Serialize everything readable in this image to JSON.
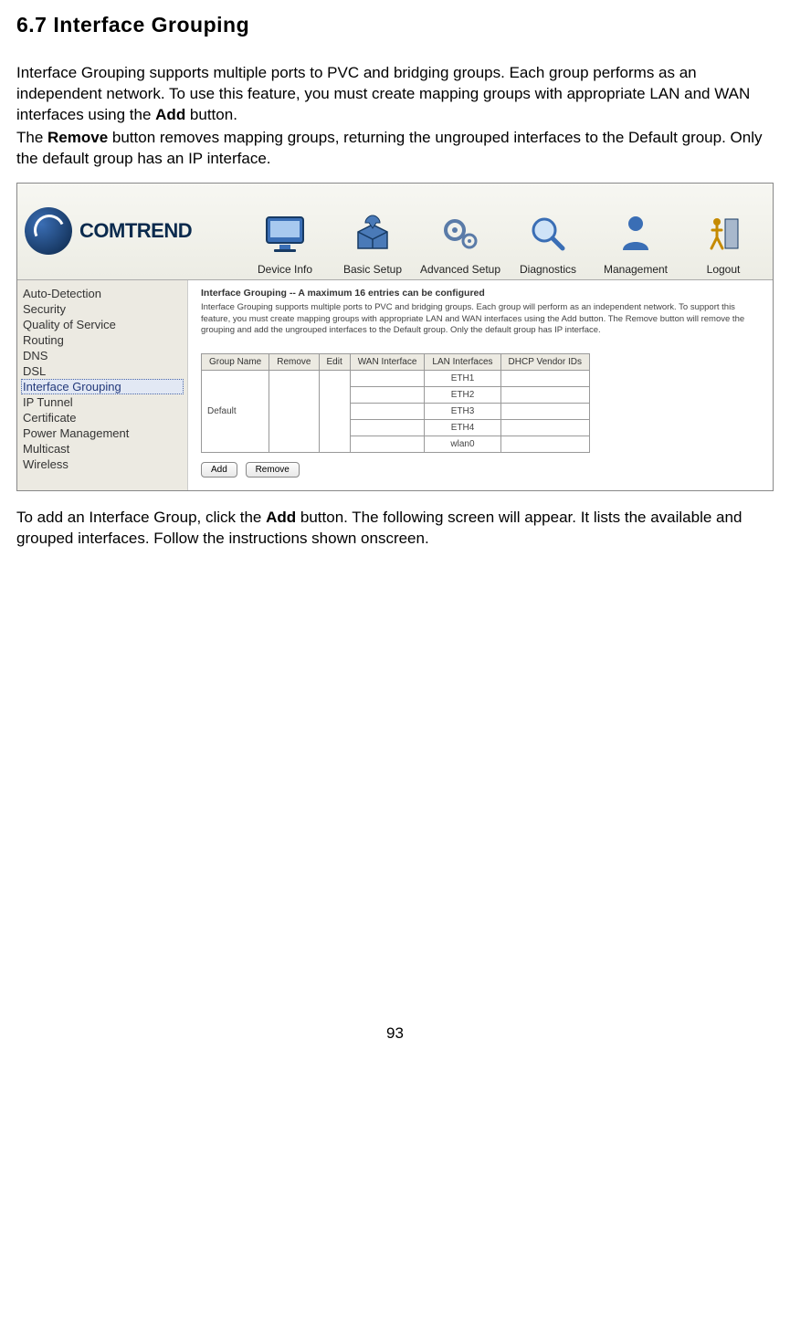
{
  "section": {
    "number": "6.7",
    "title": "Interface Grouping"
  },
  "para1_pre": "Interface Grouping supports multiple ports to PVC and bridging groups. Each group performs as an independent network. To use this feature, you must create mapping groups with appropriate LAN and WAN interfaces using the ",
  "para1_bold": "Add",
  "para1_post": " button.",
  "para2_pre": "The ",
  "para2_bold": "Remove",
  "para2_post": " button removes mapping groups, returning the ungrouped interfaces to the Default group. Only the default group has an IP interface.",
  "logo_text": "COMTREND",
  "topnav": [
    {
      "label": "Device Info"
    },
    {
      "label": "Basic Setup"
    },
    {
      "label": "Advanced Setup"
    },
    {
      "label": "Diagnostics"
    },
    {
      "label": "Management"
    },
    {
      "label": "Logout"
    }
  ],
  "sidebar": {
    "items": [
      {
        "label": "Auto-Detection"
      },
      {
        "label": "Security"
      },
      {
        "label": "Quality of Service"
      },
      {
        "label": "Routing"
      },
      {
        "label": "DNS"
      },
      {
        "label": "DSL"
      },
      {
        "label": "Interface Grouping",
        "selected": true
      },
      {
        "label": "IP Tunnel"
      },
      {
        "label": "Certificate"
      },
      {
        "label": "Power Management"
      },
      {
        "label": "Multicast"
      },
      {
        "label": "Wireless"
      }
    ]
  },
  "panel": {
    "title": "Interface Grouping -- A maximum 16 entries can be configured",
    "desc": "Interface Grouping supports multiple ports to PVC and bridging groups. Each group will perform as an independent network. To support this feature, you must create mapping groups with appropriate LAN and WAN interfaces using the Add button. The Remove button will remove the grouping and add the ungrouped interfaces to the Default group. Only the default group has IP interface.",
    "headers": [
      "Group Name",
      "Remove",
      "Edit",
      "WAN Interface",
      "LAN Interfaces",
      "DHCP Vendor IDs"
    ],
    "group_name": "Default",
    "lan_rows": [
      "ETH1",
      "ETH2",
      "ETH3",
      "ETH4",
      "wlan0"
    ],
    "add_label": "Add",
    "remove_label": "Remove"
  },
  "para3_pre": "To add an Interface Group, click the ",
  "para3_bold": "Add",
  "para3_post": " button. The following screen will appear. It lists the available and grouped interfaces. Follow the instructions shown onscreen.",
  "page_number": "93"
}
